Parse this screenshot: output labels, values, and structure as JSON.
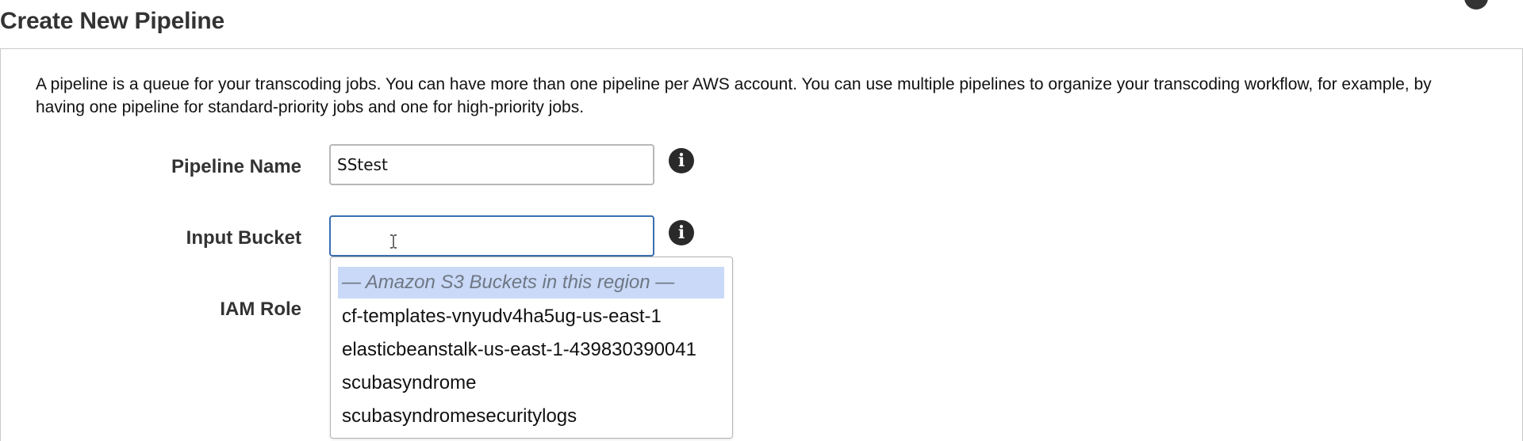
{
  "header": {
    "title": "Create New Pipeline"
  },
  "intro_text": "A pipeline is a queue for your transcoding jobs. You can have more than one pipeline per AWS account. You can use multiple pipelines to organize your transcoding workflow, for example, by having one pipeline for standard-priority jobs and one for high-priority jobs.",
  "form": {
    "pipeline_name": {
      "label": "Pipeline Name",
      "value": "SStest"
    },
    "input_bucket": {
      "label": "Input Bucket",
      "value": "",
      "focused": true
    },
    "iam_role": {
      "label": "IAM Role"
    }
  },
  "bucket_dropdown": {
    "group_header": "— Amazon S3 Buckets in this region —",
    "options": [
      "cf-templates-vnyudv4ha5ug-us-east-1",
      "elasticbeanstalk-us-east-1-439830390041",
      "scubasyndrome",
      "scubasyndromesecuritylogs"
    ]
  },
  "icons": {
    "info": "info-icon",
    "cursor": "text-cursor-icon"
  },
  "colors": {
    "focus_border": "#3a6fb3",
    "dropdown_highlight": "#c9d9f7",
    "info_icon_fill": "#2a2a2a"
  }
}
